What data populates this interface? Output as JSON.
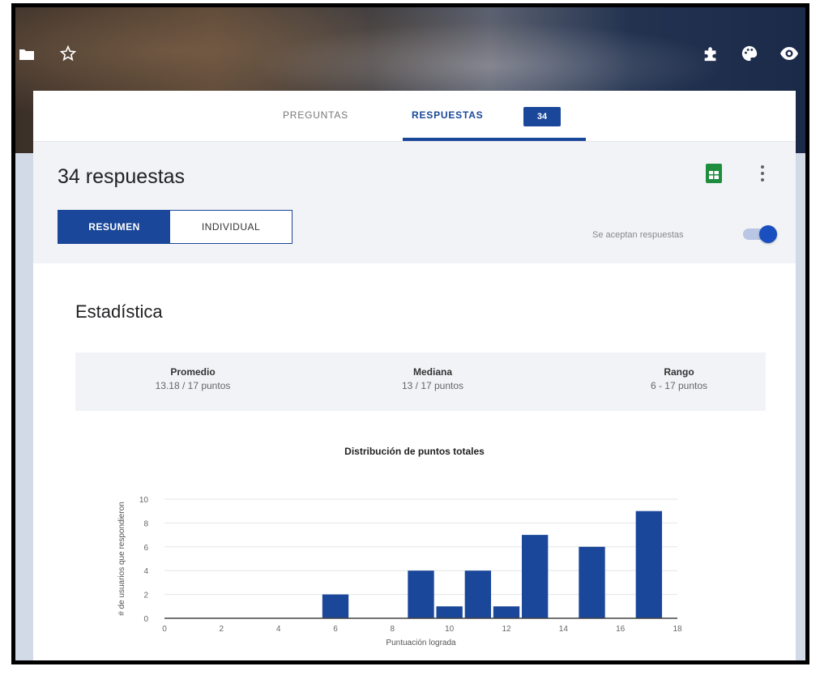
{
  "tabs": {
    "preguntas": "PREGUNTAS",
    "respuestas": "RESPUESTAS",
    "respuestas_count": "34"
  },
  "summary": {
    "title": "34 respuestas",
    "view_resumen": "RESUMEN",
    "view_individual": "INDIVIDUAL",
    "accepting_label": "Se aceptan respuestas",
    "accepting_on": true
  },
  "stats": {
    "title": "Estadística",
    "promedio_label": "Promedio",
    "promedio_value": "13.18 / 17 puntos",
    "mediana_label": "Mediana",
    "mediana_value": "13 / 17 puntos",
    "rango_label": "Rango",
    "rango_value": "6 - 17 puntos"
  },
  "chart_data": {
    "type": "bar",
    "title": "Distribución de puntos totales",
    "xlabel": "Puntuación lograda",
    "ylabel": "# de usuarios que respondieron",
    "xlim": [
      0,
      18
    ],
    "ylim": [
      0,
      10
    ],
    "xticks": [
      0,
      2,
      4,
      6,
      8,
      10,
      12,
      14,
      16,
      18
    ],
    "yticks": [
      0,
      2,
      4,
      6,
      8,
      10
    ],
    "x": [
      6,
      9,
      10,
      11,
      12,
      13,
      15,
      17
    ],
    "values": [
      2,
      4,
      1,
      4,
      1,
      7,
      6,
      9
    ],
    "color": "#1a4799"
  },
  "colors": {
    "accent": "#1a4799",
    "sheets": "#1e8e3e"
  },
  "icons": [
    "folder-icon",
    "star-icon",
    "puzzle-icon",
    "palette-icon",
    "eye-icon",
    "sheets-icon",
    "more-vert-icon"
  ]
}
